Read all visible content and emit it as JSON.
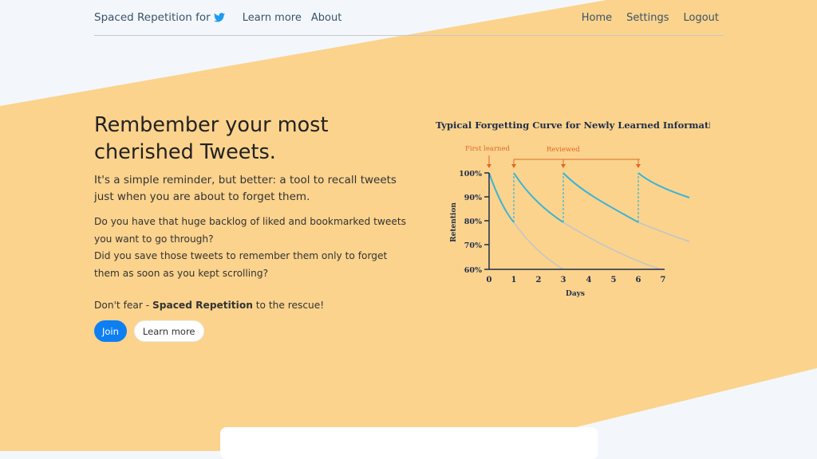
{
  "nav": {
    "brand": "Spaced Repetition for",
    "brand_icon": "twitter-bird-icon",
    "links_left": [
      "Learn more",
      "About"
    ],
    "links_right": [
      "Home",
      "Settings",
      "Logout"
    ]
  },
  "hero": {
    "title": "Rembember your most cherished Tweets.",
    "lead": "It's a simple reminder, but better: a tool to recall tweets just when you are about to forget them.",
    "para1": "Do you have that huge backlog of liked and bookmarked tweets you want to go through?",
    "para2": "Did you save those tweets to remember them only to forget them as soon as you kept scrolling?",
    "cta_prefix": "Don't fear - ",
    "cta_bold": "Spaced Repetition",
    "cta_suffix": " to the rescue!",
    "join_label": "Join",
    "learn_label": "Learn more"
  },
  "chart": {
    "title": "Typical Forgetting Curve for Newly Learned Information",
    "ylabel": "Retention",
    "xlabel": "Days",
    "first_label": "First learned",
    "reviewed_label": "Reviewed",
    "y_ticks": [
      "100%",
      "90%",
      "80%",
      "70%",
      "60%"
    ],
    "x_ticks": [
      "0",
      "1",
      "2",
      "3",
      "4",
      "5",
      "6",
      "7"
    ]
  },
  "colors": {
    "band": "#fbd38d",
    "page_bg": "#f3f7fb",
    "primary": "#0d7ff3",
    "curve": "#3ab4d6",
    "curve_faded": "#bfc5cc",
    "annotation": "#e0682a"
  }
}
